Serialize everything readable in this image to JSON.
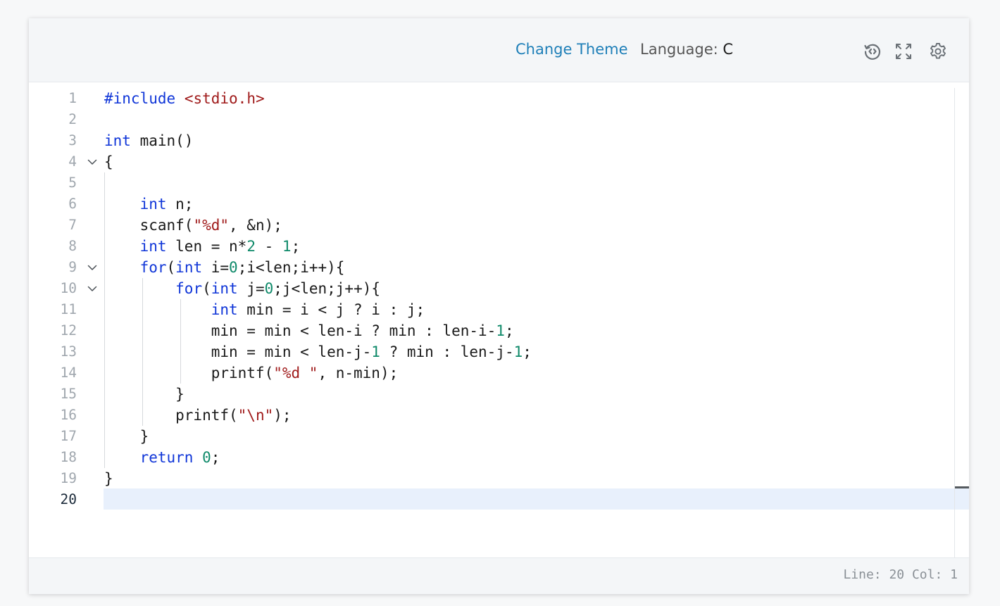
{
  "toolbar": {
    "change_theme": "Change Theme",
    "language_label": "Language:",
    "language_value": "C",
    "icons": [
      "history-icon",
      "fullscreen-icon",
      "gear-icon"
    ]
  },
  "editor": {
    "line_numbers": [
      "1",
      "2",
      "3",
      "4",
      "5",
      "6",
      "7",
      "8",
      "9",
      "10",
      "11",
      "12",
      "13",
      "14",
      "15",
      "16",
      "17",
      "18",
      "19",
      "20"
    ],
    "active_line": 20,
    "fold_lines": [
      4,
      9,
      10
    ],
    "lines": [
      "#include <stdio.h>",
      "",
      "int main()",
      "{",
      "",
      "    int n;",
      "    scanf(\"%d\", &n);",
      "    int len = n*2 - 1;",
      "    for(int i=0;i<len;i++){",
      "        for(int j=0;j<len;j++){",
      "            int min = i < j ? i : j;",
      "            min = min < len-i ? min : len-i-1;",
      "            min = min < len-j-1 ? min : len-j-1;",
      "            printf(\"%d \", n-min);",
      "        }",
      "        printf(\"\\n\");",
      "    }",
      "    return 0;",
      "}",
      ""
    ]
  },
  "statusbar": {
    "position": "Line: 20 Col: 1"
  },
  "colors": {
    "keyword": "#1036d8",
    "string": "#a01b1b",
    "number": "#0f8a6a",
    "link": "#1e7fb8"
  }
}
